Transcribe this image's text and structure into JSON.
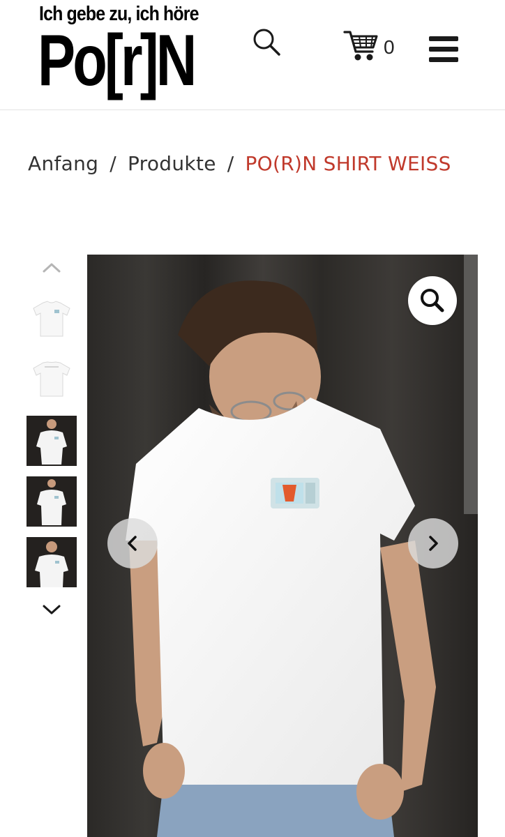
{
  "header": {
    "logo_tagline": "Ich gebe zu, ich höre",
    "logo_word": "Po[r]N",
    "search_icon": "search-icon",
    "cart_icon": "cart-icon",
    "cart_count": "0",
    "menu_icon": "hamburger-menu-icon"
  },
  "breadcrumb": {
    "items": [
      "Anfang",
      "Produkte"
    ],
    "separator": "/",
    "current": "PO(R)N SHIRT WEISS"
  },
  "gallery": {
    "thumbnails": 5,
    "prev_icon": "chevron-up-icon",
    "next_icon": "chevron-down-icon",
    "zoom_icon": "magnifier-icon",
    "slider_prev_icon": "chevron-left-icon",
    "slider_next_icon": "chevron-right-icon"
  },
  "colors": {
    "accent": "#c0392b",
    "text": "#333333",
    "backdrop": "#2a2826"
  }
}
